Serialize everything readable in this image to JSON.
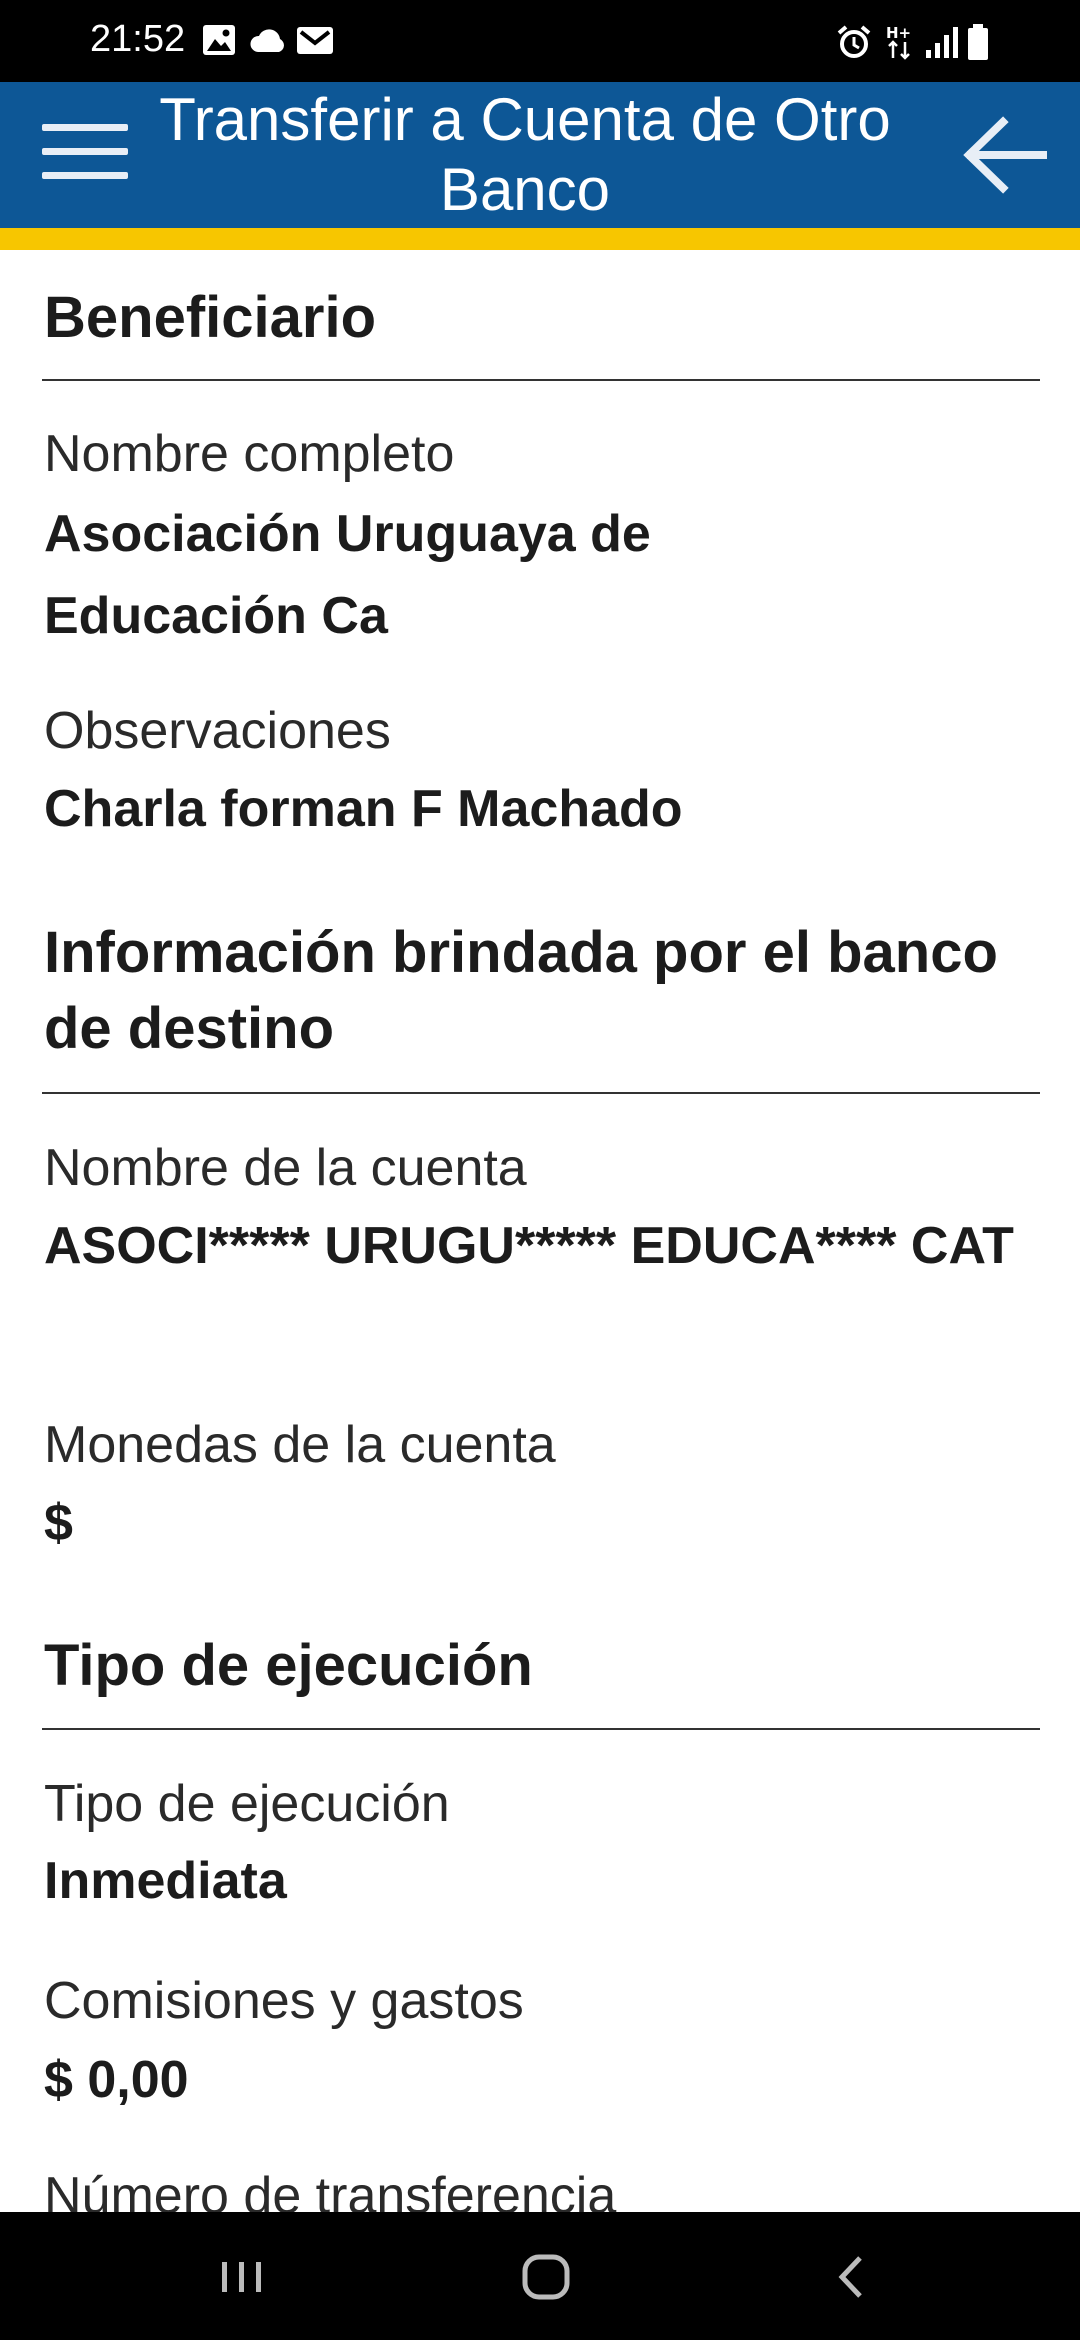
{
  "status_bar": {
    "time": "21:52"
  },
  "header": {
    "title": "Transferir a Cuenta de Otro Banco"
  },
  "sections": {
    "beneficiario": {
      "title": "Beneficiario",
      "nombre_label": "Nombre completo",
      "nombre_value": "Asociación Uruguaya de Educación Ca",
      "obs_label": "Observaciones",
      "obs_value": "Charla forman F Machado"
    },
    "banco_destino": {
      "title": "Información brindada por el banco de destino",
      "cuenta_label": "Nombre de la cuenta",
      "cuenta_value": "ASOCI***** URUGU***** EDUCA**** CAT",
      "monedas_label": "Monedas de la cuenta",
      "monedas_value": "$"
    },
    "ejecucion": {
      "title": "Tipo de ejecución",
      "tipo_label": "Tipo de ejecución",
      "tipo_value": "Inmediata",
      "comisiones_label": "Comisiones y gastos",
      "comisiones_value": "$ 0,00",
      "numero_label": "Número de transferencia"
    }
  },
  "colors": {
    "app_bar": "#0d5796",
    "accent": "#f7c600"
  }
}
